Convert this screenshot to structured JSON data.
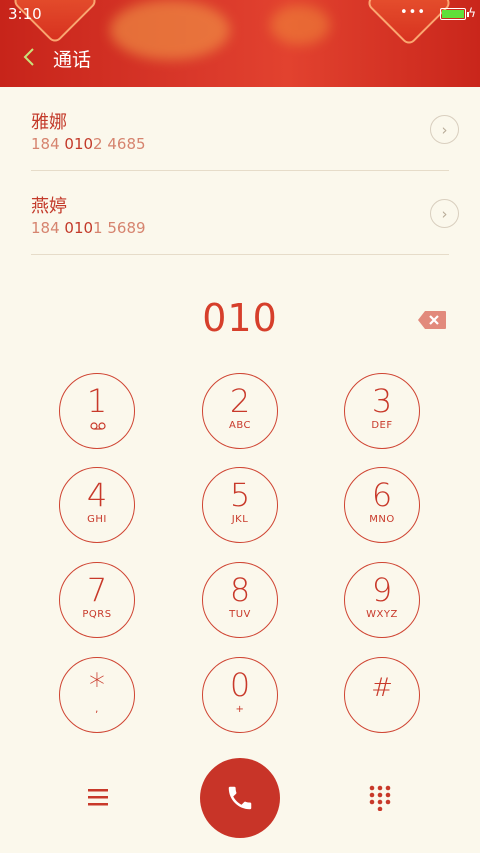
{
  "status": {
    "time": "3:10"
  },
  "header": {
    "title": "通话"
  },
  "contacts": [
    {
      "name": "雅娜",
      "num_prefix": "184 ",
      "num_match": "010",
      "num_suffix": "2 4685"
    },
    {
      "name": "燕婷",
      "num_prefix": "184 ",
      "num_match": "010",
      "num_suffix": "1 5689"
    }
  ],
  "dialer": {
    "display": "010",
    "keys": [
      {
        "digit": "1",
        "letters": ""
      },
      {
        "digit": "2",
        "letters": "ABC"
      },
      {
        "digit": "3",
        "letters": "DEF"
      },
      {
        "digit": "4",
        "letters": "GHI"
      },
      {
        "digit": "5",
        "letters": "JKL"
      },
      {
        "digit": "6",
        "letters": "MNO"
      },
      {
        "digit": "7",
        "letters": "PQRS"
      },
      {
        "digit": "8",
        "letters": "TUV"
      },
      {
        "digit": "9",
        "letters": "WXYZ"
      },
      {
        "digit": "*",
        "letters": ","
      },
      {
        "digit": "0",
        "letters": "+"
      },
      {
        "digit": "#",
        "letters": ""
      }
    ]
  },
  "colors": {
    "accent": "#c83428",
    "header": "#d9382a",
    "background": "#fbf8ec"
  },
  "icons": {
    "back": "chevron-left-icon",
    "delete": "backspace-icon",
    "menu": "hamburger-menu-icon",
    "call": "phone-icon",
    "keypad": "dialpad-icon",
    "voicemail": "voicemail-icon"
  }
}
